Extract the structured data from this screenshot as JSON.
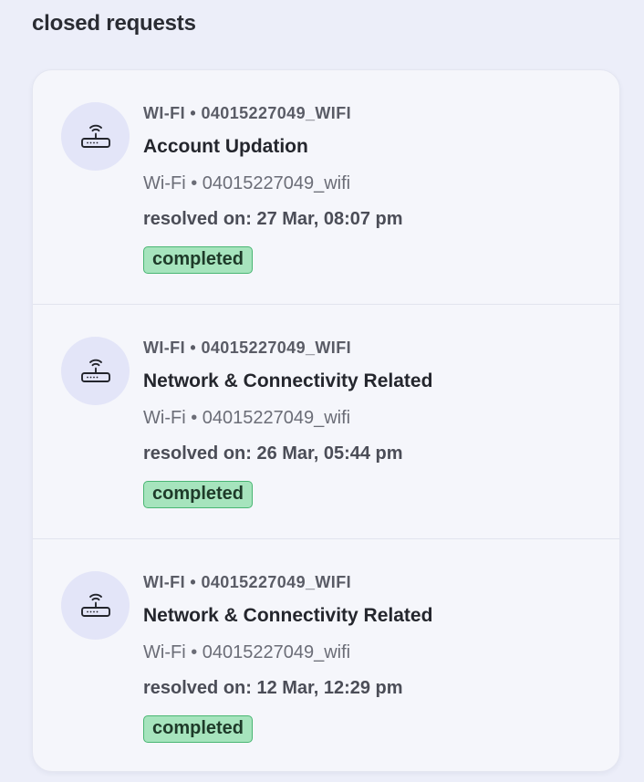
{
  "section": {
    "title": "closed requests"
  },
  "requests": [
    {
      "icon": "router-wifi-icon",
      "eyebrow": "WI-FI • 04015227049_WIFI",
      "title": "Account Updation",
      "subtitle": "Wi-Fi • 04015227049_wifi",
      "resolved": "resolved on: 27 Mar, 08:07 pm",
      "status": "completed"
    },
    {
      "icon": "router-wifi-icon",
      "eyebrow": "WI-FI • 04015227049_WIFI",
      "title": "Network & Connectivity Related",
      "subtitle": "Wi-Fi • 04015227049_wifi",
      "resolved": "resolved on: 26 Mar, 05:44 pm",
      "status": "completed"
    },
    {
      "icon": "router-wifi-icon",
      "eyebrow": "WI-FI • 04015227049_WIFI",
      "title": "Network & Connectivity Related",
      "subtitle": "Wi-Fi • 04015227049_wifi",
      "resolved": "resolved on: 12 Mar, 12:29 pm",
      "status": "completed"
    }
  ],
  "colors": {
    "page_background": "#eceef9",
    "card_background": "#f5f6fb",
    "icon_circle": "#e3e5f8",
    "badge_fill": "#a6e4bd",
    "badge_border": "#49b673"
  }
}
